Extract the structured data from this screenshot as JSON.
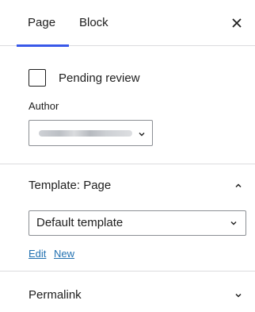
{
  "tabs": {
    "page_label": "Page",
    "block_label": "Block",
    "close_icon": "close-icon"
  },
  "status": {
    "pending_review_label": "Pending review",
    "pending_review_checked": false,
    "author_label": "Author",
    "author_value_redacted": true
  },
  "template": {
    "header_title": "Template: Page",
    "expanded": true,
    "selected": "Default template",
    "edit_label": "Edit",
    "new_label": "New"
  },
  "permalink": {
    "header_title": "Permalink",
    "expanded": false
  },
  "colors": {
    "accent": "#3858e9",
    "link": "#2271b1",
    "border": "#dcdcde",
    "text": "#1e1e1e"
  }
}
